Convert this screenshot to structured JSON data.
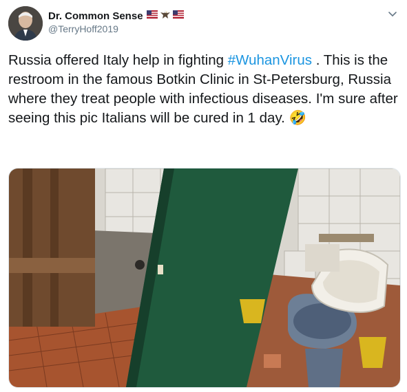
{
  "header": {
    "display_name": "Dr. Common Sense",
    "handle": "@TerryHoff2019",
    "badges": [
      "us-flag-icon",
      "eagle-icon",
      "us-flag-icon"
    ]
  },
  "tweet": {
    "text_before": "Russia offered Italy help in fighting ",
    "hashtag": "#WuhanVirus",
    "text_after": " . This is the restroom in the famous Botkin Clinic in St-Petersburg, Russia where they treat people with infectious diseases. I'm sure after seeing this pic Italians will be cured in 1 day. ",
    "emoji": "🤣"
  },
  "media": {
    "icon": "photo-restroom"
  },
  "colors": {
    "hashtag": "#1b95e0",
    "handle": "#657786",
    "text": "#14171a"
  }
}
